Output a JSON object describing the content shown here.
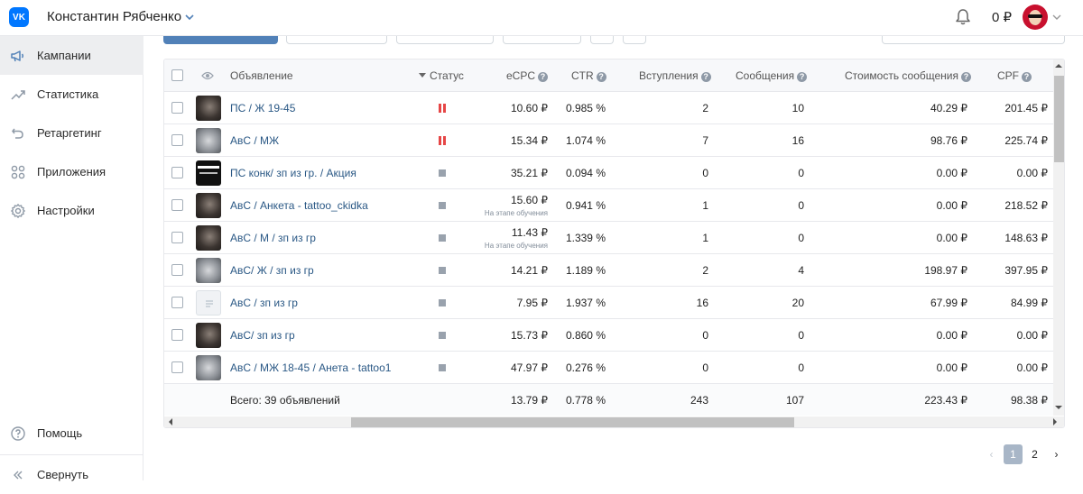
{
  "header": {
    "logo_text": "VK",
    "user_name": "Константин Рябченко",
    "balance": "0 ₽"
  },
  "sidebar": {
    "items": [
      {
        "label": "Кампании",
        "icon": "megaphone-icon",
        "active": true
      },
      {
        "label": "Статистика",
        "icon": "chart-line-icon",
        "active": false
      },
      {
        "label": "Ретаргетинг",
        "icon": "retarget-arrow-icon",
        "active": false
      },
      {
        "label": "Приложения",
        "icon": "apps-grid-icon",
        "active": false
      },
      {
        "label": "Настройки",
        "icon": "gear-icon",
        "active": false
      }
    ],
    "help_label": "Помощь",
    "collapse_label": "Свернуть"
  },
  "table": {
    "columns": {
      "ad": "Объявление",
      "status": "Статус",
      "ecpc": "eCPC",
      "ctr": "CTR",
      "joins": "Вступления",
      "messages": "Сообщения",
      "msg_cost": "Стоимость сообщения",
      "cpf": "CPF"
    },
    "rows": [
      {
        "name": "ПС / Ж 19-45",
        "status": "paused",
        "ecpc": "10.60 ₽",
        "ecpc_note": "",
        "ctr": "0.985 %",
        "joins": "2",
        "messages": "10",
        "msg_cost": "40.29 ₽",
        "cpf": "201.45 ₽",
        "thumb": "dark"
      },
      {
        "name": "АвС / МЖ",
        "status": "paused",
        "ecpc": "15.34 ₽",
        "ecpc_note": "",
        "ctr": "1.074 %",
        "joins": "7",
        "messages": "16",
        "msg_cost": "98.76 ₽",
        "cpf": "225.74 ₽",
        "thumb": "gray"
      },
      {
        "name": "ПС конк/ зп из гр. / Акция",
        "status": "stopped",
        "ecpc": "35.21 ₽",
        "ecpc_note": "",
        "ctr": "0.094 %",
        "joins": "0",
        "messages": "0",
        "msg_cost": "0.00 ₽",
        "cpf": "0.00 ₽",
        "thumb": "text"
      },
      {
        "name": "АвС / Анкета - tattoo_ckidka",
        "status": "stopped",
        "ecpc": "15.60 ₽",
        "ecpc_note": "На этапе обучения",
        "ctr": "0.941 %",
        "joins": "1",
        "messages": "0",
        "msg_cost": "0.00 ₽",
        "cpf": "218.52 ₽",
        "thumb": "dark"
      },
      {
        "name": "АвС / М / зп из гр",
        "status": "stopped",
        "ecpc": "11.43 ₽",
        "ecpc_note": "На этапе обучения",
        "ctr": "1.339 %",
        "joins": "1",
        "messages": "0",
        "msg_cost": "0.00 ₽",
        "cpf": "148.63 ₽",
        "thumb": "dark"
      },
      {
        "name": "АвС/ Ж / зп из гр",
        "status": "stopped",
        "ecpc": "14.21 ₽",
        "ecpc_note": "",
        "ctr": "1.189 %",
        "joins": "2",
        "messages": "4",
        "msg_cost": "198.97 ₽",
        "cpf": "397.95 ₽",
        "thumb": "gray"
      },
      {
        "name": "АвС / зп из гр",
        "status": "stopped",
        "ecpc": "7.95 ₽",
        "ecpc_note": "",
        "ctr": "1.937 %",
        "joins": "16",
        "messages": "20",
        "msg_cost": "67.99 ₽",
        "cpf": "84.99 ₽",
        "thumb": "placeholder"
      },
      {
        "name": "АвС/ зп из гр",
        "status": "stopped",
        "ecpc": "15.73 ₽",
        "ecpc_note": "",
        "ctr": "0.860 %",
        "joins": "0",
        "messages": "0",
        "msg_cost": "0.00 ₽",
        "cpf": "0.00 ₽",
        "thumb": "dark"
      },
      {
        "name": "АвС / МЖ 18-45 / Анета - tattoo1",
        "status": "stopped",
        "ecpc": "47.97 ₽",
        "ecpc_note": "",
        "ctr": "0.276 %",
        "joins": "0",
        "messages": "0",
        "msg_cost": "0.00 ₽",
        "cpf": "0.00 ₽",
        "thumb": "gray"
      }
    ],
    "total": {
      "label": "Всего: 39 объявлений",
      "ecpc": "13.79 ₽",
      "ctr": "0.778 %",
      "joins": "243",
      "messages": "107",
      "msg_cost": "223.43 ₽",
      "cpf": "98.38 ₽"
    },
    "help_glyph": "?"
  },
  "pagination": {
    "prev": "‹",
    "pages": [
      "1",
      "2"
    ],
    "current": "1",
    "next": "›"
  },
  "colors": {
    "link": "#2a5885",
    "paused": "#e64646",
    "stopped": "#99a2ad",
    "primary": "#5181b8"
  }
}
